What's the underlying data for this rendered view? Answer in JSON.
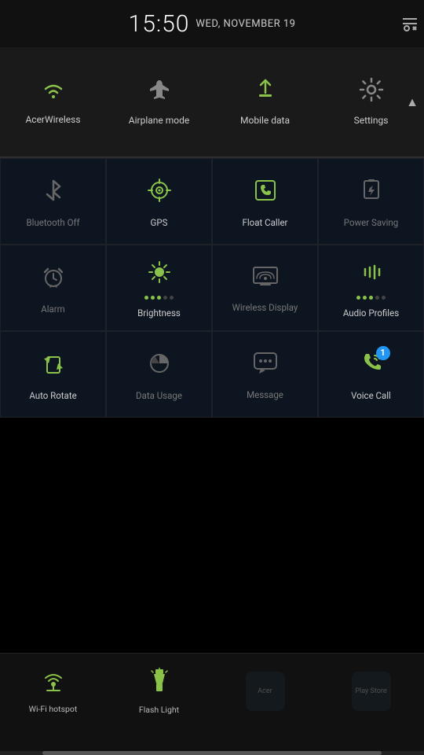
{
  "statusBar": {
    "time": "15:50",
    "date": "WED, NOVEMBER 19",
    "toolsLabel": "⚒"
  },
  "topRow": {
    "tiles": [
      {
        "id": "wifi",
        "label": "AcerWireless",
        "iconType": "wifi",
        "active": true
      },
      {
        "id": "airplane",
        "label": "Airplane mode",
        "iconType": "airplane",
        "active": false
      },
      {
        "id": "mobiledata",
        "label": "Mobile data",
        "iconType": "upload",
        "active": false
      },
      {
        "id": "settings",
        "label": "Settings",
        "iconType": "gear",
        "active": false
      }
    ],
    "chevron": "▲"
  },
  "mainGrid": {
    "tiles": [
      {
        "id": "bluetooth",
        "label": "Bluetooth Off",
        "iconType": "bluetooth",
        "active": false
      },
      {
        "id": "gps",
        "label": "GPS",
        "iconType": "gps",
        "active": true
      },
      {
        "id": "floatcaller",
        "label": "Float Caller",
        "iconType": "floatcaller",
        "active": true
      },
      {
        "id": "powersaving",
        "label": "Power Saving",
        "iconType": "powersaving",
        "active": false
      },
      {
        "id": "alarm",
        "label": "Alarm",
        "iconType": "alarm",
        "active": false
      },
      {
        "id": "brightness",
        "label": "Brightness",
        "iconType": "brightness",
        "active": true
      },
      {
        "id": "wireless",
        "label": "Wireless Display",
        "iconType": "wireless",
        "active": false
      },
      {
        "id": "audioprofiles",
        "label": "Audio Profiles",
        "iconType": "audio",
        "active": true
      },
      {
        "id": "autorotate",
        "label": "Auto Rotate",
        "iconType": "autorotate",
        "active": true
      },
      {
        "id": "datausage",
        "label": "Data Usage",
        "iconType": "datausage",
        "active": false
      },
      {
        "id": "message",
        "label": "Message",
        "iconType": "message",
        "active": false
      },
      {
        "id": "voicecall",
        "label": "Voice Call",
        "iconType": "voicecall",
        "active": true,
        "badge": "1"
      }
    ]
  },
  "bottomRow": {
    "tiles": [
      {
        "id": "wifihotspot",
        "label": "Wi-Fi hotspot",
        "iconType": "hotspot",
        "active": true
      },
      {
        "id": "flashlight",
        "label": "Flash Light",
        "iconType": "flashlight",
        "active": false
      }
    ],
    "apps": [
      {
        "id": "acer",
        "label": "Acer"
      },
      {
        "id": "playstore",
        "label": "Play Store"
      }
    ]
  },
  "scrollbar": {
    "thumbWidth": "80%"
  }
}
